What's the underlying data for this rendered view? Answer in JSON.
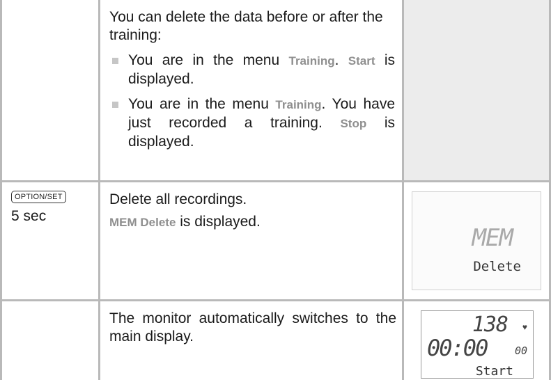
{
  "rows": [
    {
      "intro": "You can delete the data before or after the training:",
      "bullets": [
        {
          "pre": "You are in the menu ",
          "hl1": "Training",
          "mid": ". ",
          "hl2": "Start",
          "post": " is displayed."
        },
        {
          "pre": "You are in the menu ",
          "hl1": "Training",
          "mid": ". You have just recorded a training. ",
          "hl2": "Stop",
          "post": " is displayed."
        }
      ]
    },
    {
      "key_label": "OPTION/SET",
      "duration": "5 sec",
      "line1": "Delete all recordings.",
      "hl": "MEM Delete",
      "line2_post": " is displayed.",
      "lcd": {
        "top": "MEM",
        "bottom": "Delete"
      }
    },
    {
      "text": "The monitor automatically switches to the main display.",
      "lcd": {
        "line1": "138",
        "line2": "00:00",
        "line2_small": "00",
        "line3": "Start"
      }
    }
  ]
}
